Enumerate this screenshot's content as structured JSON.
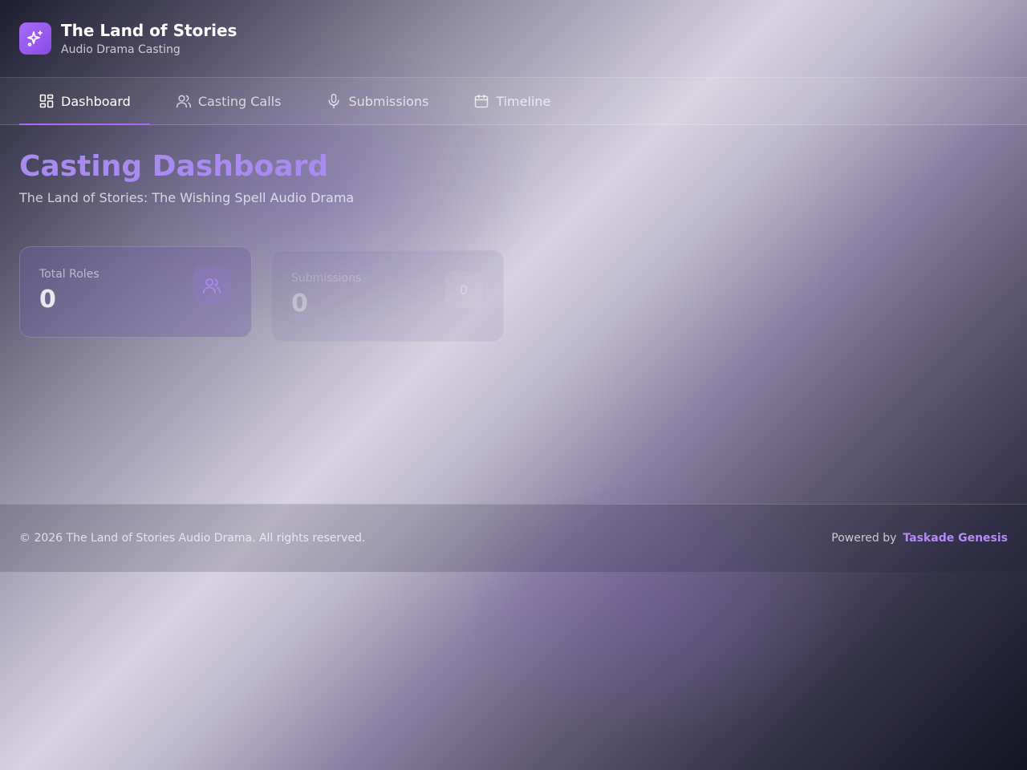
{
  "app": {
    "title": "The Land of Stories",
    "subtitle": "Audio Drama Casting",
    "logo_icon": "sparkles-icon",
    "accent_color": "#a86bf5"
  },
  "nav": {
    "tabs": [
      {
        "label": "Dashboard",
        "icon": "dashboard-icon",
        "active": true
      },
      {
        "label": "Casting Calls",
        "icon": "users-icon",
        "active": false
      },
      {
        "label": "Submissions",
        "icon": "microphone-icon",
        "active": false
      },
      {
        "label": "Timeline",
        "icon": "calendar-icon",
        "active": false
      }
    ]
  },
  "main": {
    "title": "Casting Dashboard",
    "subtitle": "The Land of Stories: The Wishing Spell Audio Drama",
    "stats": [
      {
        "label": "Total Roles",
        "value": "0",
        "icon": "users-icon"
      },
      {
        "label": "Submissions",
        "value": "0",
        "icon_text": "0"
      }
    ]
  },
  "footer": {
    "copyright": "© 2026 The Land of Stories Audio Drama. All rights reserved.",
    "powered_by_label": "Powered by",
    "powered_by_link": "Taskade Genesis"
  }
}
